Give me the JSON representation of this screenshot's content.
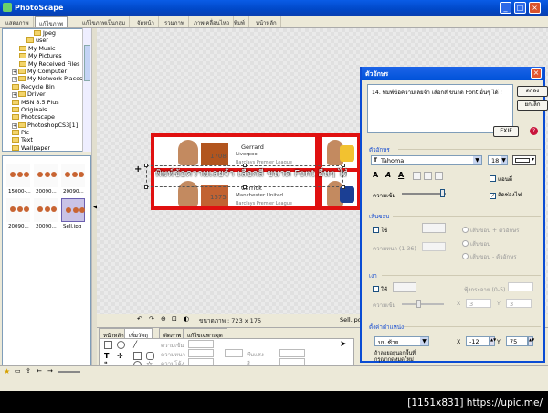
{
  "window": {
    "title": "PhotoScape"
  },
  "tabs": [
    "แสดงภาพ",
    "แก้ไขภาพ",
    "แก้ไขภาพเป็นกลุ่ม",
    "จัดหน้า",
    "รวมภาพ",
    "ภาพเคลื่อนไหว",
    "พิมพ์",
    "หน้าหลัก"
  ],
  "active_tab": 1,
  "folder_tree": [
    {
      "label": "Jpeg",
      "indent": 4
    },
    {
      "label": "user",
      "indent": 3
    },
    {
      "label": "My Music",
      "indent": 2
    },
    {
      "label": "My Pictures",
      "indent": 2
    },
    {
      "label": "My Received Files",
      "indent": 2
    },
    {
      "label": "My Computer",
      "indent": 1,
      "expander": "+"
    },
    {
      "label": "My Network Places",
      "indent": 1,
      "expander": "+"
    },
    {
      "label": "Recycle Bin",
      "indent": 1
    },
    {
      "label": "Driver",
      "indent": 1,
      "expander": "+"
    },
    {
      "label": "MSN 8.5 Plus",
      "indent": 1
    },
    {
      "label": "Originals",
      "indent": 1
    },
    {
      "label": "Photoscape",
      "indent": 1
    },
    {
      "label": "PhotoshopCS3[1]",
      "indent": 1,
      "expander": "+"
    },
    {
      "label": "Pic",
      "indent": 1
    },
    {
      "label": "Text",
      "indent": 1
    },
    {
      "label": "Wallpaper",
      "indent": 1
    }
  ],
  "thumbnails": [
    {
      "caption": "15000-..."
    },
    {
      "caption": "20090..."
    },
    {
      "caption": "20090..."
    },
    {
      "caption": "20090..."
    },
    {
      "caption": "20090..."
    },
    {
      "caption": "Sell.jpg"
    }
  ],
  "canvas": {
    "overlay_text": "พิมพ์ข้อความเลยจ้า เลือกสี ขนาด Font อื่นๆ ได้ !",
    "cards": [
      {
        "number": "1708",
        "name": "Gerrard",
        "club": "Liverpool",
        "league": "Barclays Premier League"
      },
      {
        "number": "1575",
        "name": "Carrick",
        "club": "Manchester United",
        "league": "Barclays Premier League"
      }
    ]
  },
  "status": {
    "size_label": "ขนาดภาพ : 723 x 175",
    "file_name": "Sell.jpg"
  },
  "bottom_tabs": [
    "หน้าหลัก",
    "เพิ่มวัตถุ",
    "ตัดภาพ",
    "แก้ไขเฉพาะจุด"
  ],
  "bottom_active_tab": 1,
  "bottom_panel": {
    "labels": [
      "ความเข้ม",
      "ความหนา",
      "ความโค้ง",
      "ทึบแสง",
      "สี"
    ]
  },
  "dialog": {
    "title": "ตัวอักษร",
    "text_value": "14. พิมพ์ข้อความเลยจ้า เลือกสี ขนาด Font อื่นๆ ได้ !",
    "ok_label": "ตกลง",
    "cancel_label": "ยกเลิก",
    "exif_label": "EXIF",
    "font_section": "ตัวอักษร",
    "font_name": "Tahoma",
    "font_size": "18",
    "text_color": "#ffffff",
    "style_buttons": [
      "A",
      "A",
      "A"
    ],
    "opacity_label": "ความเข้ม",
    "antialias_label": "แอนตี้",
    "align_center_label": "จัดช่องไฟ",
    "antialias_checked": false,
    "align_checked": true,
    "border_section": "เส้นขอบ",
    "border_use": "ใช้",
    "border_width_label": "ความหนา (1-36)",
    "border_options": [
      "เส้นขอบ + ตัวอักษร",
      "เส้นขอบ",
      "เส้นขอบ - ตัวอักษร"
    ],
    "shadow_section": "เงา",
    "shadow_use": "ใช้",
    "shadow_blur_label": "ฟุ้งกระจาย (0-5)",
    "shadow_opacity_label": "ความเข้ม",
    "shadow_x_label": "X",
    "shadow_y_label": "Y",
    "shadow_x": "3",
    "shadow_y": "3",
    "position_section": "ตั้งค่าตำแหน่ง",
    "position_align": "บน ซ้าย",
    "pos_x_label": "X",
    "pos_x": "-12",
    "pos_y_label": "Y",
    "pos_y": "75",
    "position_hint_1": "ถ้าลอยอยู่นอกพื้นที่",
    "position_hint_2": "กรุณากดหมดใหม่"
  },
  "credit": "[1151x831] https://upic.me/"
}
